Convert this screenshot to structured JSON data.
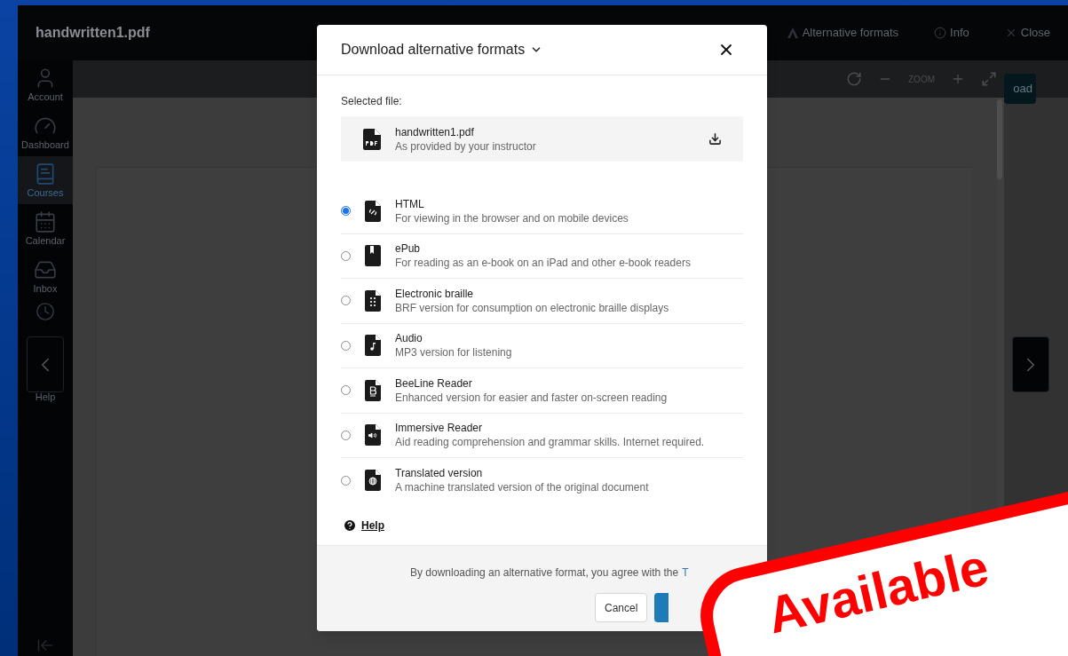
{
  "app": {
    "file_title": "handwritten1.pdf",
    "header_actions": [
      {
        "kind": "alt",
        "label": "Alternative formats"
      },
      {
        "kind": "info",
        "label": "Info"
      },
      {
        "kind": "close",
        "label": "Close"
      }
    ],
    "sidebar": [
      {
        "kind": "account",
        "label": "Account",
        "selected": false
      },
      {
        "kind": "dashboard",
        "label": "Dashboard",
        "selected": false
      },
      {
        "kind": "courses",
        "label": "Courses",
        "selected": true
      },
      {
        "kind": "calendar",
        "label": "Calendar",
        "selected": false
      },
      {
        "kind": "inbox",
        "label": "Inbox",
        "selected": false
      },
      {
        "kind": "history",
        "selected": false
      },
      {
        "kind": "help",
        "label": "Help",
        "selected": false
      }
    ],
    "toolbar": {
      "zoom_label": "ZOOM"
    },
    "download_button": "oad"
  },
  "dialog": {
    "title": "Download alternative formats",
    "selected_file_label": "Selected file:",
    "file": {
      "name": "handwritten1.pdf",
      "note": "As provided by your instructor"
    },
    "formats": [
      {
        "kind": "link",
        "name": "HTML",
        "description": "For viewing in the browser and on mobile devices",
        "selected": true
      },
      {
        "kind": "bookmark",
        "name": "ePub",
        "description": "For reading as an e-book on an iPad and other e-book readers",
        "selected": false
      },
      {
        "kind": "braille",
        "name": "Electronic braille",
        "description": "BRF version for consumption on electronic braille displays",
        "selected": false
      },
      {
        "kind": "music",
        "name": "Audio",
        "description": "MP3 version for listening",
        "selected": false
      },
      {
        "kind": "letter",
        "name": "BeeLine Reader",
        "description": "Enhanced version for easier and faster on-screen reading",
        "selected": false
      },
      {
        "kind": "speaker",
        "name": "Immersive Reader",
        "description": "Aid reading comprehension and grammar skills. Internet required.",
        "selected": false
      },
      {
        "kind": "globe",
        "name": "Translated version",
        "description": "A machine translated version of the original document",
        "selected": false
      }
    ],
    "help_link": "Help",
    "agreement": "By downloading an alternative format, you agree with the",
    "agreement_link": "T",
    "cancel_button": "Cancel"
  },
  "sticker": {
    "text": "Available"
  }
}
